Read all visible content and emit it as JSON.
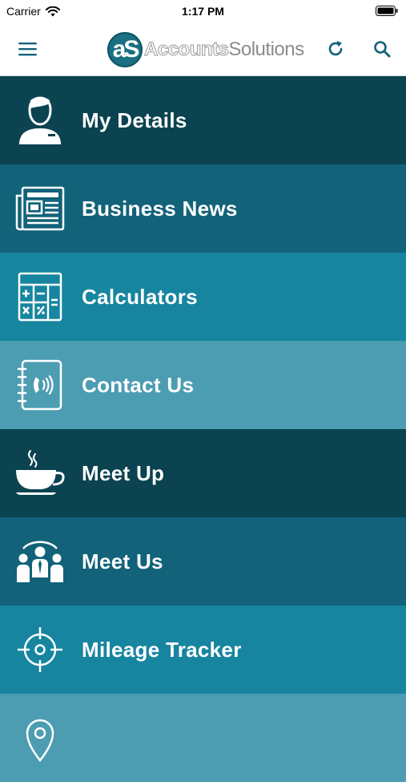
{
  "status_bar": {
    "carrier": "Carrier",
    "time": "1:17 PM"
  },
  "header": {
    "logo_mark": "aS",
    "logo_text_1": "Accounts",
    "logo_text_2": "Solutions",
    "icons": {
      "menu": "hamburger-icon",
      "refresh": "refresh-icon",
      "search": "search-icon"
    }
  },
  "menu": {
    "items": [
      {
        "label": "My Details",
        "icon": "person-icon",
        "color": "#0b4350"
      },
      {
        "label": "Business News",
        "icon": "newspaper-icon",
        "color": "#12627a"
      },
      {
        "label": "Calculators",
        "icon": "calculator-icon",
        "color": "#17859f"
      },
      {
        "label": "Contact Us",
        "icon": "address-book-phone-icon",
        "color": "#4d9db2"
      },
      {
        "label": "Meet Up",
        "icon": "coffee-cup-icon",
        "color": "#0b4350"
      },
      {
        "label": "Meet Us",
        "icon": "team-icon",
        "color": "#12627a"
      },
      {
        "label": "Mileage Tracker",
        "icon": "target-icon",
        "color": "#17859f"
      },
      {
        "label": "",
        "icon": "location-pin-icon",
        "color": "#4d9db2"
      }
    ]
  }
}
